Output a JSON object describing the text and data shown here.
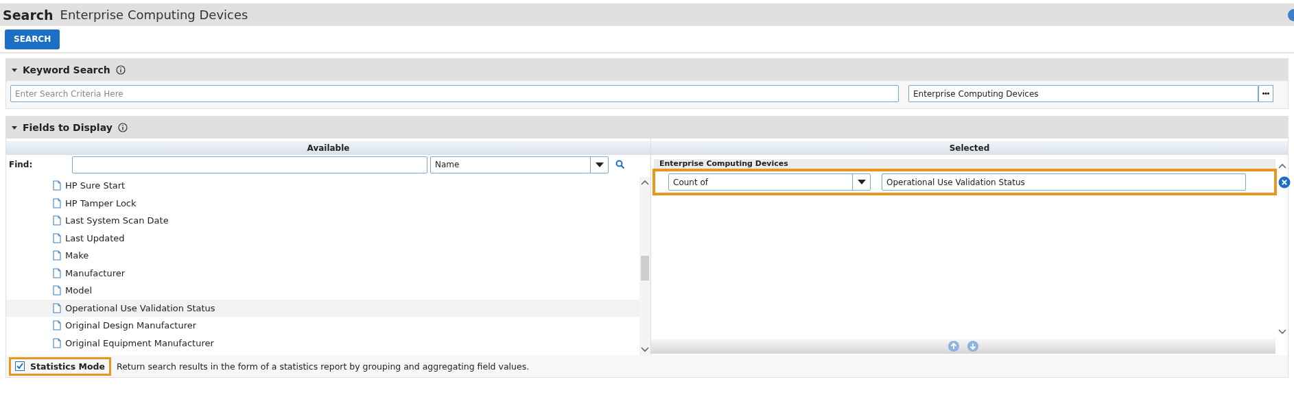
{
  "header": {
    "title": "Search",
    "subtitle": "Enterprise Computing Devices"
  },
  "search_button": "SEARCH",
  "keyword_search": {
    "title": "Keyword Search",
    "expanded": true,
    "criteria": {
      "placeholder": "Enter Search Criteria Here"
    },
    "scope": {
      "value": "Enterprise Computing Devices",
      "button": "•••"
    }
  },
  "fields_to_display": {
    "title": "Fields to Display",
    "expanded": true,
    "available": {
      "heading": "Available",
      "find_label": "Find:",
      "find_by": "Name",
      "items": [
        {
          "label": "HP Sure Start",
          "selected": false
        },
        {
          "label": "HP Tamper Lock",
          "selected": false
        },
        {
          "label": "Last System Scan Date",
          "selected": false
        },
        {
          "label": "Last Updated",
          "selected": false
        },
        {
          "label": "Make",
          "selected": false
        },
        {
          "label": "Manufacturer",
          "selected": false
        },
        {
          "label": "Model",
          "selected": false
        },
        {
          "label": "Operational Use Validation Status",
          "selected": true
        },
        {
          "label": "Original Design Manufacturer",
          "selected": false
        },
        {
          "label": "Original Equipment Manufacturer",
          "selected": false
        }
      ]
    },
    "selected": {
      "heading": "Selected",
      "group": "Enterprise Computing Devices",
      "rows": [
        {
          "aggregate": "Count of",
          "field": "Operational Use Validation Status",
          "highlighted": true
        }
      ]
    }
  },
  "statistics_mode": {
    "label": "Statistics Mode",
    "checked": true,
    "highlighted": true,
    "description": "Return search results in the form of a statistics report by grouping and aggregating field values."
  }
}
